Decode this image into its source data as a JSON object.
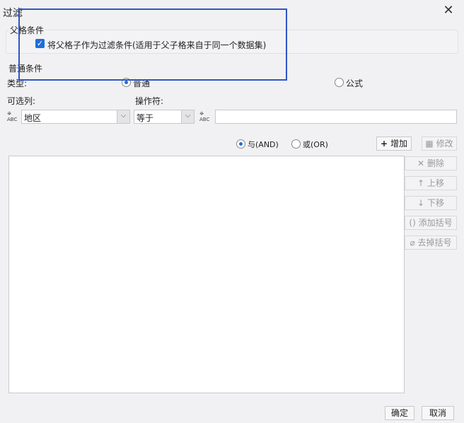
{
  "window": {
    "title": "过滤"
  },
  "parent_conditions": {
    "label": "父格条件",
    "checkbox_label": "将父格子作为过滤条件(适用于父子格来自于同一个数据集)"
  },
  "normal_conditions": {
    "label": "普通条件",
    "type_label": "类型:",
    "type_options": {
      "normal": "普通",
      "formula": "公式"
    },
    "column_label": "可选列:",
    "operator_label": "操作符:",
    "column_value": "地区",
    "operator_value": "等于",
    "value_text": ""
  },
  "logic": {
    "and_label": "与(AND)",
    "or_label": "或(OR)"
  },
  "buttons": {
    "add": "增加",
    "modify": "修改",
    "delete": "删除",
    "move_up": "上移",
    "move_down": "下移",
    "add_bracket": "添加括号",
    "remove_bracket": "去掉括号",
    "ok": "确定",
    "cancel": "取消"
  },
  "icons": {
    "close": "close-icon",
    "column": "abc-column-icon",
    "value": "abc-value-icon"
  }
}
